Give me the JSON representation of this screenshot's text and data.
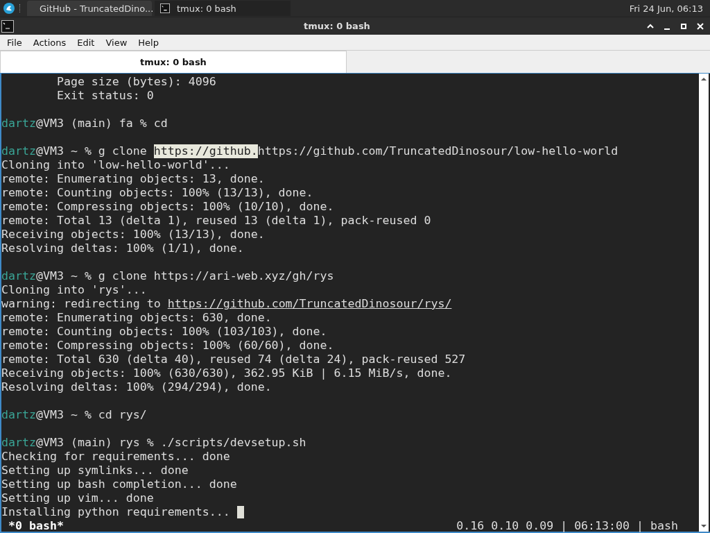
{
  "taskbar": {
    "tasks": [
      {
        "label": "GitHub - TruncatedDino...",
        "kind": "browser",
        "selected": true
      },
      {
        "label": "tmux: 0 bash",
        "kind": "terminal",
        "selected": false
      }
    ],
    "clock": "Fri 24 Jun, 06:13"
  },
  "window": {
    "title": "tmux: 0 bash"
  },
  "menu": [
    "File",
    "Actions",
    "Edit",
    "View",
    "Help"
  ],
  "tabs": [
    {
      "label": "tmux: 0 bash",
      "selected": true
    }
  ],
  "terminal": {
    "lines": [
      {
        "segments": [
          {
            "kind": "plain",
            "text": "        Page size (bytes): 4096"
          }
        ]
      },
      {
        "segments": [
          {
            "kind": "plain",
            "text": "        Exit status: 0"
          }
        ]
      },
      {
        "gap_before": true,
        "segments": [
          {
            "kind": "user",
            "text": "dartz"
          },
          {
            "kind": "plain",
            "text": "@VM3 (main) fa % cd"
          }
        ]
      },
      {
        "gap_before": true,
        "segments": [
          {
            "kind": "user",
            "text": "dartz"
          },
          {
            "kind": "plain",
            "text": "@VM3 ~ % g clone "
          },
          {
            "kind": "highlight",
            "text": "https://github."
          },
          {
            "kind": "plain",
            "text": "https://github.com/TruncatedDinosour/low-hello-world"
          }
        ]
      },
      {
        "segments": [
          {
            "kind": "plain",
            "text": "Cloning into 'low-hello-world'..."
          }
        ]
      },
      {
        "segments": [
          {
            "kind": "plain",
            "text": "remote: Enumerating objects: 13, done."
          }
        ]
      },
      {
        "segments": [
          {
            "kind": "plain",
            "text": "remote: Counting objects: 100% (13/13), done."
          }
        ]
      },
      {
        "segments": [
          {
            "kind": "plain",
            "text": "remote: Compressing objects: 100% (10/10), done."
          }
        ]
      },
      {
        "segments": [
          {
            "kind": "plain",
            "text": "remote: Total 13 (delta 1), reused 13 (delta 1), pack-reused 0"
          }
        ]
      },
      {
        "segments": [
          {
            "kind": "plain",
            "text": "Receiving objects: 100% (13/13), done."
          }
        ]
      },
      {
        "segments": [
          {
            "kind": "plain",
            "text": "Resolving deltas: 100% (1/1), done."
          }
        ]
      },
      {
        "gap_before": true,
        "segments": [
          {
            "kind": "user",
            "text": "dartz"
          },
          {
            "kind": "plain",
            "text": "@VM3 ~ % g clone https://ari-web.xyz/gh/rys"
          }
        ]
      },
      {
        "segments": [
          {
            "kind": "plain",
            "text": "Cloning into 'rys'..."
          }
        ]
      },
      {
        "segments": [
          {
            "kind": "plain",
            "text": "warning: redirecting to "
          },
          {
            "kind": "link",
            "text": "https://github.com/TruncatedDinosour/rys/"
          }
        ]
      },
      {
        "segments": [
          {
            "kind": "plain",
            "text": "remote: Enumerating objects: 630, done."
          }
        ]
      },
      {
        "segments": [
          {
            "kind": "plain",
            "text": "remote: Counting objects: 100% (103/103), done."
          }
        ]
      },
      {
        "segments": [
          {
            "kind": "plain",
            "text": "remote: Compressing objects: 100% (60/60), done."
          }
        ]
      },
      {
        "segments": [
          {
            "kind": "plain",
            "text": "remote: Total 630 (delta 40), reused 74 (delta 24), pack-reused 527"
          }
        ]
      },
      {
        "segments": [
          {
            "kind": "plain",
            "text": "Receiving objects: 100% (630/630), 362.95 KiB | 6.15 MiB/s, done."
          }
        ]
      },
      {
        "segments": [
          {
            "kind": "plain",
            "text": "Resolving deltas: 100% (294/294), done."
          }
        ]
      },
      {
        "gap_before": true,
        "segments": [
          {
            "kind": "user",
            "text": "dartz"
          },
          {
            "kind": "plain",
            "text": "@VM3 ~ % cd rys/"
          }
        ]
      },
      {
        "gap_before": true,
        "segments": [
          {
            "kind": "user",
            "text": "dartz"
          },
          {
            "kind": "plain",
            "text": "@VM3 (main) rys % ./scripts/devsetup.sh"
          }
        ]
      },
      {
        "segments": [
          {
            "kind": "plain",
            "text": "Checking for requirements... done"
          }
        ]
      },
      {
        "segments": [
          {
            "kind": "plain",
            "text": "Setting up symlinks... done"
          }
        ]
      },
      {
        "segments": [
          {
            "kind": "plain",
            "text": "Setting up bash completion... done"
          }
        ]
      },
      {
        "segments": [
          {
            "kind": "plain",
            "text": "Setting up vim... done"
          }
        ]
      },
      {
        "segments": [
          {
            "kind": "plain",
            "text": "Installing python requirements... "
          }
        ],
        "cursor": true
      }
    ],
    "status_left": " *0 bash*",
    "status_right": "0.16 0.10 0.09 | 06:13:00 | bash"
  }
}
